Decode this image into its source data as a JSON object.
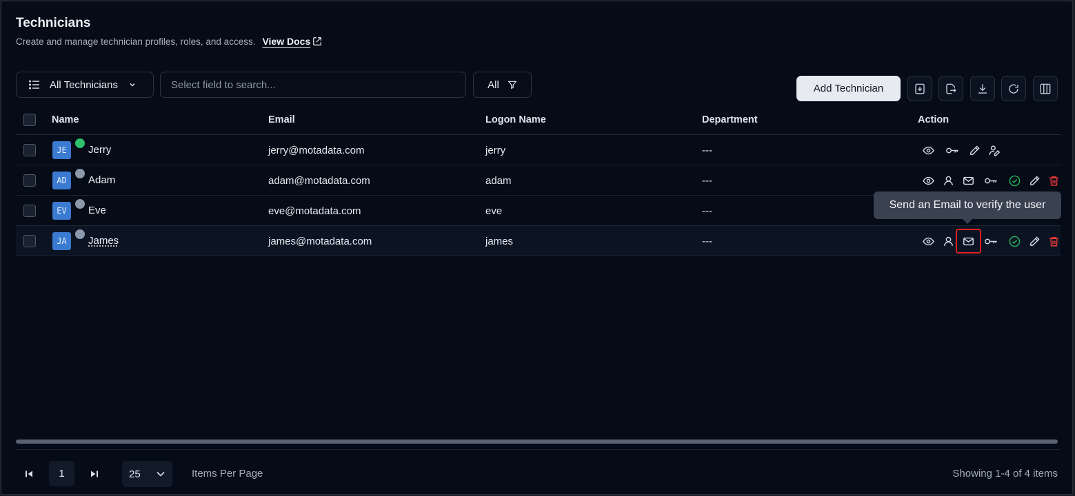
{
  "header": {
    "title": "Technicians",
    "subtitle": "Create and manage technician profiles, roles, and access.",
    "docs_link": "View Docs"
  },
  "toolbar": {
    "view_select": "All Technicians",
    "search_placeholder": "Select field to search...",
    "filter_label": "All",
    "add_button": "Add Technician",
    "icon_buttons": [
      "import-icon",
      "export-icon",
      "download-icon",
      "refresh-icon",
      "columns-icon"
    ]
  },
  "table": {
    "columns": {
      "name": "Name",
      "email": "Email",
      "logon": "Logon Name",
      "department": "Department",
      "action": "Action"
    },
    "rows": [
      {
        "initials": "JE",
        "status": "online",
        "name": "Jerry",
        "email": "jerry@motadata.com",
        "logon": "jerry",
        "department": "---"
      },
      {
        "initials": "AD",
        "status": "offline",
        "name": "Adam",
        "email": "adam@motadata.com",
        "logon": "adam",
        "department": "---"
      },
      {
        "initials": "EV",
        "status": "offline",
        "name": "Eve",
        "email": "eve@motadata.com",
        "logon": "eve",
        "department": "---"
      },
      {
        "initials": "JA",
        "status": "offline",
        "name": "James",
        "email": "james@motadata.com",
        "logon": "james",
        "department": "---"
      }
    ]
  },
  "tooltip": "Send an Email to verify the user",
  "pagination": {
    "current_page": "1",
    "per_page": "25",
    "per_page_label": "Items Per Page",
    "showing": "Showing 1-4 of 4 items"
  },
  "colors": {
    "online": "#2ec06a",
    "offline": "#8c98ab",
    "delete": "#ef3c3c",
    "verified": "#27b75f",
    "highlight_box": "#e02020"
  }
}
